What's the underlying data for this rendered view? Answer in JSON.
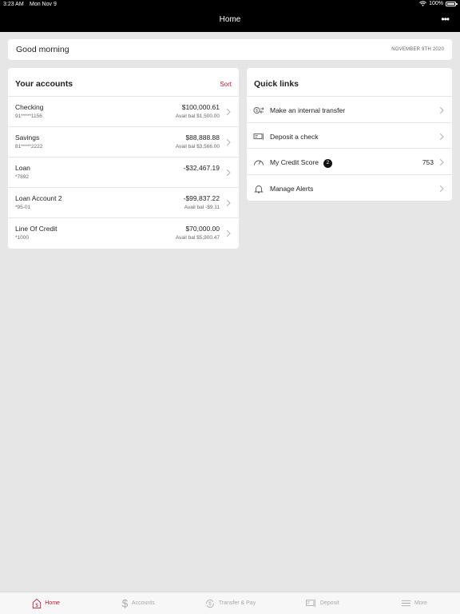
{
  "status_bar": {
    "time": "3:23 AM",
    "date": "Mon Nov 9",
    "battery": "100%"
  },
  "nav": {
    "title": "Home",
    "more": "•••"
  },
  "greeting": {
    "text": "Good morning",
    "date": "NOVEMBER 9TH 2020"
  },
  "accounts": {
    "title": "Your accounts",
    "sort_label": "Sort",
    "items": [
      {
        "name": "Checking",
        "number": "91*****1156",
        "amount": "$100,000.61",
        "avail": "Avail bal $1,500.00"
      },
      {
        "name": "Savings",
        "number": "81*****2222",
        "amount": "$88,888.88",
        "avail": "Avail bal $3,566.00"
      },
      {
        "name": "Loan",
        "number": "*7892",
        "amount": "-$32,467.19",
        "avail": ""
      },
      {
        "name": "Loan Account 2",
        "number": "*95-01",
        "amount": "-$99,837.22",
        "avail": "Avail bal -$9.11"
      },
      {
        "name": "Line Of Credit",
        "number": "*1000",
        "amount": "$70,000.00",
        "avail": "Avail bal $5,900.47"
      }
    ]
  },
  "quick_links": {
    "title": "Quick links",
    "items": [
      {
        "label": "Make an internal transfer",
        "icon": "transfer-icon",
        "badge": "",
        "value": ""
      },
      {
        "label": "Deposit a check",
        "icon": "check-icon",
        "badge": "",
        "value": ""
      },
      {
        "label": "My Credit Score",
        "icon": "gauge-icon",
        "badge": "2",
        "value": "753"
      },
      {
        "label": "Manage Alerts",
        "icon": "bell-icon",
        "badge": "",
        "value": ""
      }
    ]
  },
  "tabs": [
    {
      "label": "Home",
      "icon": "home-icon",
      "active": true
    },
    {
      "label": "Accounts",
      "icon": "dollar-icon",
      "active": false
    },
    {
      "label": "Transfer & Pay",
      "icon": "transfer-pay-icon",
      "active": false
    },
    {
      "label": "Deposit",
      "icon": "deposit-icon",
      "active": false
    },
    {
      "label": "More",
      "icon": "menu-icon",
      "active": false
    }
  ],
  "colors": {
    "accent": "#b01b35",
    "background": "#e6e6e6",
    "nav_bar": "#000000"
  }
}
